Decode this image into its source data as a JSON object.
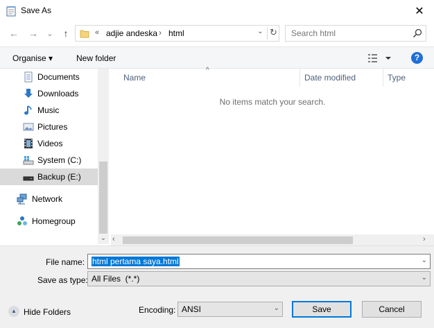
{
  "window": {
    "title": "Save As",
    "close_glyph": "✕",
    "title_icon": "notepad-icon"
  },
  "address": {
    "back_glyph": "←",
    "forward_glyph": "→",
    "recent_glyph": "⌄",
    "up_glyph": "↑",
    "overflow": "«",
    "crumbs": [
      "adjie andeska",
      "html"
    ],
    "separator": "›",
    "dropdown_glyph": "⌄",
    "refresh_glyph": "↻"
  },
  "search": {
    "placeholder": "Search html",
    "icon": "search-icon"
  },
  "toolbar": {
    "organise_label": "Organise ▾",
    "new_folder_label": "New folder",
    "help_glyph": "?"
  },
  "nav": {
    "items": [
      {
        "label": "Documents",
        "icon": "documents-icon"
      },
      {
        "label": "Downloads",
        "icon": "downloads-icon"
      },
      {
        "label": "Music",
        "icon": "music-icon"
      },
      {
        "label": "Pictures",
        "icon": "pictures-icon"
      },
      {
        "label": "Videos",
        "icon": "videos-icon"
      },
      {
        "label": "System (C:)",
        "icon": "drive-icon"
      },
      {
        "label": "Backup (E:)",
        "icon": "drive-icon",
        "selected": true
      },
      {
        "label": "Network",
        "icon": "network-icon"
      },
      {
        "label": "Homegroup",
        "icon": "homegroup-icon"
      }
    ]
  },
  "filelist": {
    "columns": [
      "Name",
      "Date modified",
      "Type"
    ],
    "empty_message": "No items match your search."
  },
  "form": {
    "filename_label": "File name:",
    "filename_value": "html pertama saya.html",
    "type_label": "Save as type:",
    "type_value": "All Files  (*.*)",
    "encoding_label": "Encoding:",
    "encoding_value": "ANSI"
  },
  "footer": {
    "hide_folders_label": "Hide Folders",
    "save_label": "Save",
    "cancel_label": "Cancel"
  },
  "colors": {
    "accent": "#0078d7",
    "selection_bg": "#dadada",
    "header_text": "#4c607a"
  }
}
